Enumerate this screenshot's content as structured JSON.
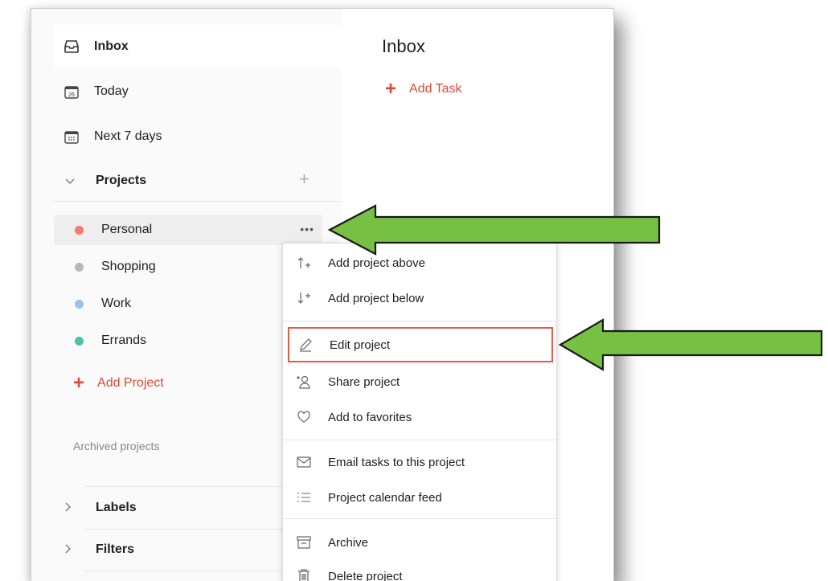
{
  "sidebar": {
    "nav": [
      {
        "label": "Inbox",
        "icon": "inbox-icon"
      },
      {
        "label": "Today",
        "icon": "calendar-today-icon",
        "day": "26"
      },
      {
        "label": "Next 7 days",
        "icon": "calendar-week-icon"
      }
    ],
    "projects_header": "Projects",
    "projects": [
      {
        "label": "Personal",
        "color": "#f47c6f"
      },
      {
        "label": "Shopping",
        "color": "#b8b8b8"
      },
      {
        "label": "Work",
        "color": "#96c3eb"
      },
      {
        "label": "Errands",
        "color": "#4cc3a6"
      }
    ],
    "more_button": "•••",
    "add_project": "Add Project",
    "archived": "Archived projects",
    "labels_header": "Labels",
    "filters_header": "Filters"
  },
  "main": {
    "title": "Inbox",
    "add_task": "Add Task"
  },
  "context_menu": {
    "items": [
      {
        "label": "Add project above",
        "icon": "arrow-up-plus-icon"
      },
      {
        "label": "Add project below",
        "icon": "arrow-down-plus-icon"
      },
      {
        "label": "Edit project",
        "icon": "pencil-icon"
      },
      {
        "label": "Share project",
        "icon": "add-person-icon"
      },
      {
        "label": "Add to favorites",
        "icon": "heart-icon"
      },
      {
        "label": "Email tasks to this project",
        "icon": "envelope-icon"
      },
      {
        "label": "Project calendar feed",
        "icon": "list-icon"
      },
      {
        "label": "Archive",
        "icon": "archive-box-icon"
      },
      {
        "label": "Delete project",
        "icon": "trash-icon"
      }
    ]
  },
  "colors": {
    "accent": "#dd4b39",
    "highlight_border": "#e45b4b",
    "arrow_fill": "#76c043"
  }
}
